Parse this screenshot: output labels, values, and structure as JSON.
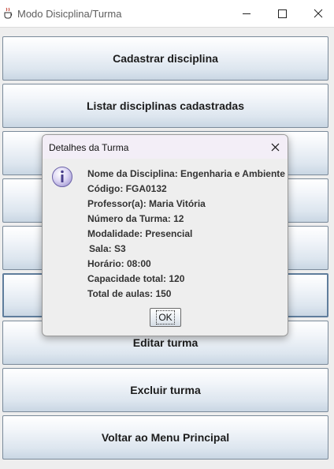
{
  "window": {
    "title": "Modo Disicplina/Turma",
    "app_icon": "java-cup-icon",
    "controls": [
      "minimize-icon",
      "maximize-icon",
      "close-icon"
    ]
  },
  "buttons": [
    {
      "label": "Cadastrar disciplina"
    },
    {
      "label": "Listar disciplinas cadastradas"
    },
    {
      "label": ""
    },
    {
      "label": ""
    },
    {
      "label": ""
    },
    {
      "label": ""
    },
    {
      "label": "Editar turma"
    },
    {
      "label": "Excluir turma"
    },
    {
      "label": "Voltar ao Menu Principal"
    }
  ],
  "dialog": {
    "title": "Detalhes da Turma",
    "icon": "info-icon",
    "lines": [
      "Nome da Disciplina: Engenharia e Ambiente",
      "Código: FGA0132",
      "Professor(a): Maria Vitória",
      "Número da Turma: 12",
      "Modalidade: Presencial",
      "Sala: S3",
      "Horário: 08:00",
      "Capacidade total: 120",
      "Total de aulas: 150"
    ],
    "ok_label": "OK"
  }
}
